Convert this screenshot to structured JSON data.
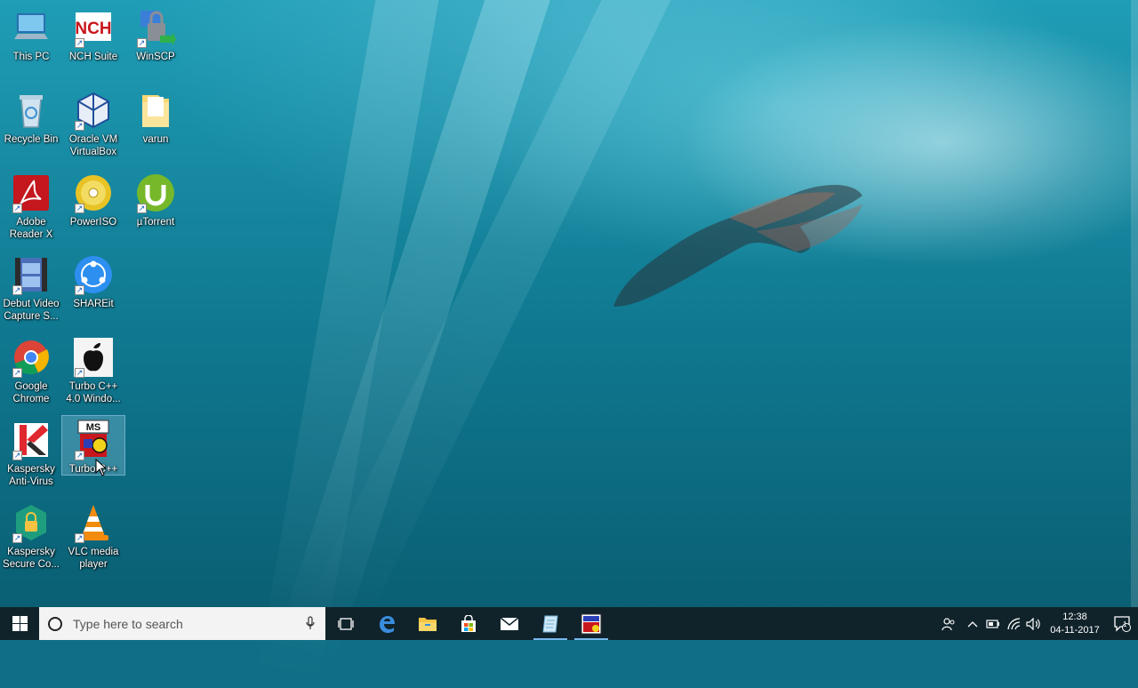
{
  "desktop": {
    "icons": [
      {
        "label": "This PC",
        "icon": "this-pc-icon"
      },
      {
        "label": "NCH Suite",
        "icon": "nch-suite-icon"
      },
      {
        "label": "WinSCP",
        "icon": "winscp-icon"
      },
      {
        "label": "Recycle Bin",
        "icon": "recycle-bin-icon"
      },
      {
        "label": "Oracle VM VirtualBox",
        "icon": "virtualbox-icon"
      },
      {
        "label": "varun",
        "icon": "folder-icon"
      },
      {
        "label": "Adobe Reader X",
        "icon": "adobe-reader-icon"
      },
      {
        "label": "PowerISO",
        "icon": "poweriso-icon"
      },
      {
        "label": "µTorrent",
        "icon": "utorrent-icon"
      },
      {
        "label": "Debut Video Capture S...",
        "icon": "debut-video-icon"
      },
      {
        "label": "SHAREit",
        "icon": "shareit-icon"
      },
      {
        "label": "Google Chrome",
        "icon": "chrome-icon"
      },
      {
        "label": "Turbo C++ 4.0 Windo...",
        "icon": "turbo-cpp-windows-icon"
      },
      {
        "label": "Kaspersky Anti-Virus",
        "icon": "kaspersky-antivirus-icon"
      },
      {
        "label": "Turbo C++",
        "icon": "turbo-cpp-icon"
      },
      {
        "label": "Kaspersky Secure Co...",
        "icon": "kaspersky-secure-icon"
      },
      {
        "label": "VLC media player",
        "icon": "vlc-icon"
      }
    ]
  },
  "taskbar": {
    "search_placeholder": "Type here to search",
    "pinned": [
      "task-view-icon",
      "edge-icon",
      "file-explorer-icon",
      "store-icon",
      "mail-icon",
      "notepad-icon",
      "turbo-app-icon"
    ],
    "clock": {
      "time": "12:38",
      "date": "04-11-2017"
    },
    "notification_count": "1"
  },
  "colors": {
    "taskbar": "#10232b",
    "accent": "#76b9ed"
  }
}
